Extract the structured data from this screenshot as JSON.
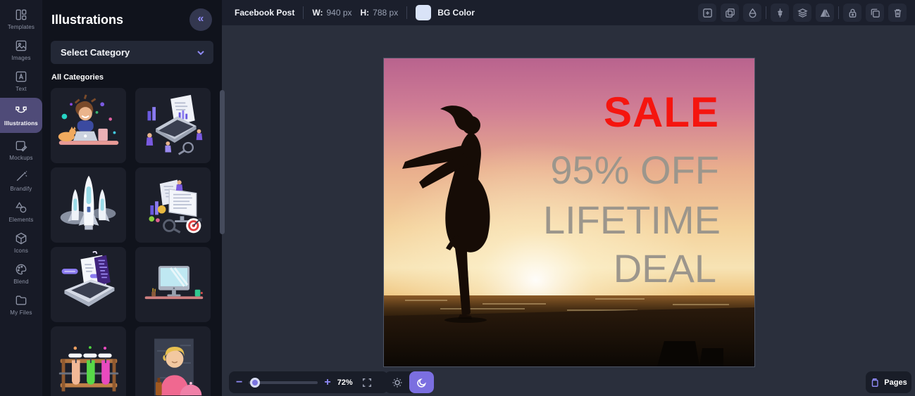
{
  "colors": {
    "accent": "#7b6fe0",
    "active_sidebar_bg": "#4f4b78",
    "panel_bg": "#10131c",
    "workspace_bg": "#2a2f3c",
    "bg_color_swatch": "#d9e3f7",
    "sale_red": "#f5150f",
    "deal_gray": "#9c968c"
  },
  "sidebar": {
    "items": [
      {
        "label": "Templates"
      },
      {
        "label": "Images"
      },
      {
        "label": "Text"
      },
      {
        "label": "Illustrations"
      },
      {
        "label": "Mockups"
      },
      {
        "label": "Brandify"
      },
      {
        "label": "Elements"
      },
      {
        "label": "Icons"
      },
      {
        "label": "Blend"
      },
      {
        "label": "My Files"
      }
    ],
    "active_item": "Illustrations"
  },
  "panel": {
    "title": "Illustrations",
    "collapse_glyph": "«",
    "category_dropdown": {
      "value": "Select Category"
    },
    "section_label": "All Categories",
    "illustrations": [
      {
        "name": "man-working-on-laptop-with-cat"
      },
      {
        "name": "isometric-laptop-analytics-team"
      },
      {
        "name": "rocket-launch"
      },
      {
        "name": "website-analysis-with-target"
      },
      {
        "name": "laptop-web-development"
      },
      {
        "name": "desktop-computer-workspace"
      },
      {
        "name": "chemistry-test-tubes-rack"
      },
      {
        "name": "chef-with-dish"
      }
    ]
  },
  "toolbar": {
    "doc_title": "Facebook Post",
    "w_label": "W:",
    "w_value": "940 px",
    "h_label": "H:",
    "h_value": "788 px",
    "bg_color_label": "BG Color",
    "icons": [
      "canvas-resize",
      "crop",
      "color-drop",
      "align-center",
      "layers",
      "flip-horizontal",
      "lock",
      "duplicate",
      "delete"
    ]
  },
  "canvas": {
    "sale_text": "SALE",
    "line1": "95% OFF",
    "line2": "LIFETIME",
    "line3": "DEAL"
  },
  "bottom_bar": {
    "zoom_out_glyph": "−",
    "zoom_in_glyph": "+",
    "zoom_percent": "72%"
  },
  "pages": {
    "label": "Pages"
  }
}
